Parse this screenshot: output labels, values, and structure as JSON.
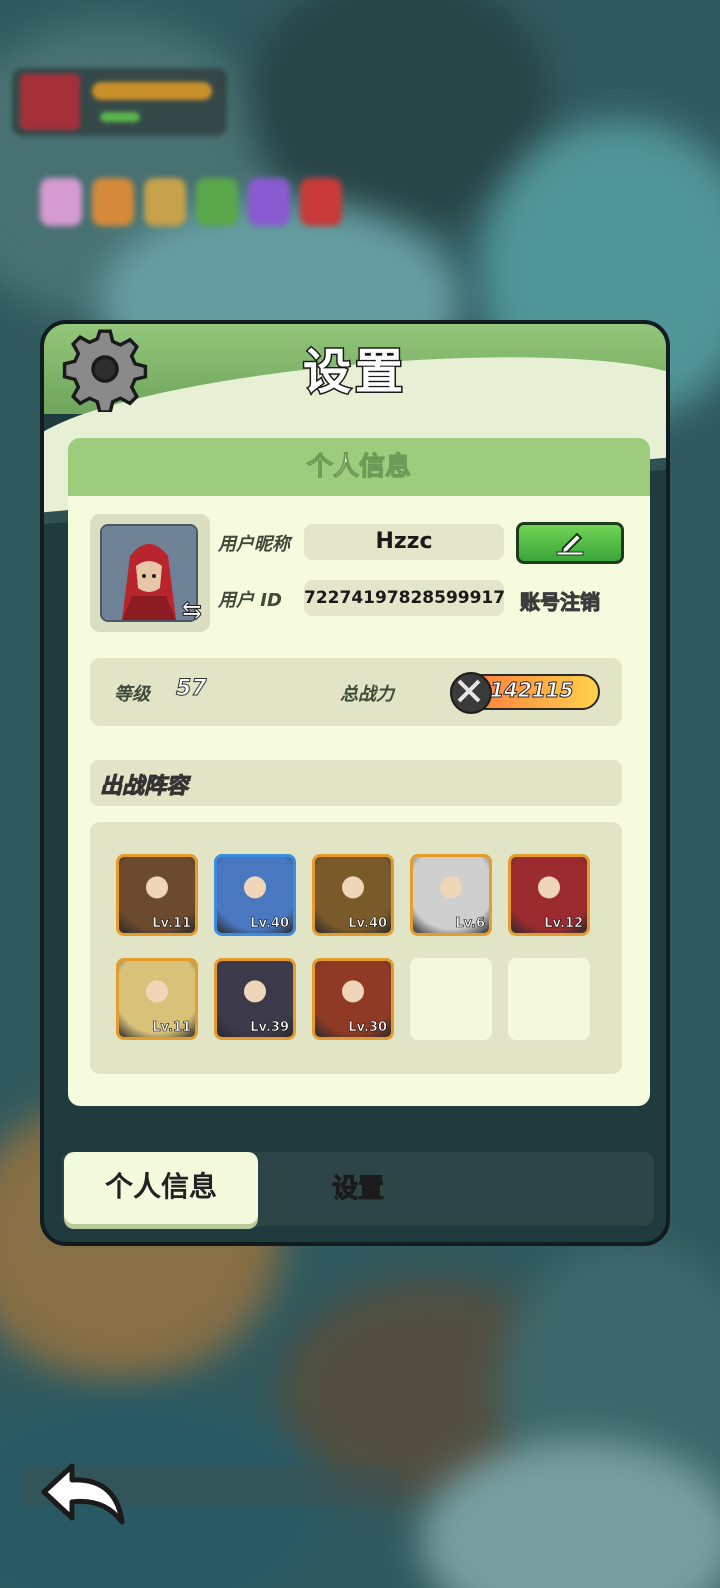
{
  "panel": {
    "title": "设置",
    "section_header": "个人信息",
    "profile": {
      "nickname_label": "用户昵称",
      "nickname": "Hzzc",
      "id_label": "用户 ID",
      "user_id": "72274197828599917",
      "logout": "账号注销",
      "swap_icon": "⇆"
    },
    "stats": {
      "level_label": "等级",
      "level": "57",
      "power_label": "总战力",
      "power": "142115"
    },
    "lineup": {
      "title": "出战阵容",
      "heroes": [
        {
          "level": "Lv.11",
          "color": "#6b4a2e"
        },
        {
          "level": "Lv.40",
          "color": "#4a78c0"
        },
        {
          "level": "Lv.40",
          "color": "#7a5a2a"
        },
        {
          "level": "Lv.6",
          "color": "#cfcfcf"
        },
        {
          "level": "Lv.12",
          "color": "#9b2b2f"
        },
        {
          "level": "Lv.11",
          "color": "#d8c27a"
        },
        {
          "level": "Lv.39",
          "color": "#3c3a4a"
        },
        {
          "level": "Lv.30",
          "color": "#8e3a24"
        }
      ],
      "empty_slots": 2
    },
    "tabs": [
      {
        "label": "个人信息",
        "active": true
      },
      {
        "label": "设置",
        "active": false
      }
    ]
  },
  "colors": {
    "accent_green": "#9ccc7c",
    "panel_bg": "#f5fbdc",
    "edit_button": "#4fbf44"
  }
}
